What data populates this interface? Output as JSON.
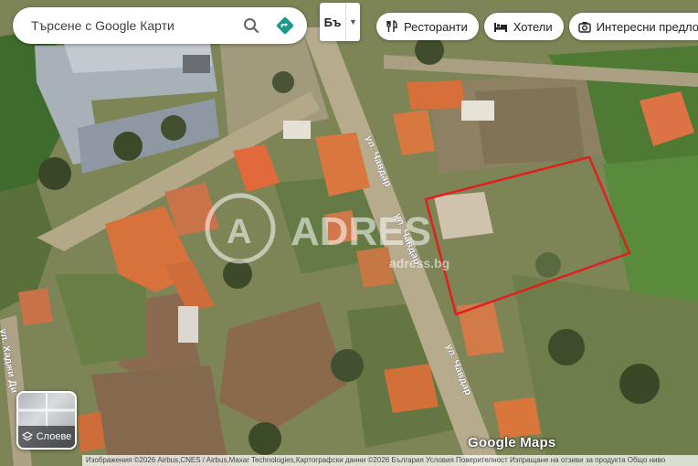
{
  "search": {
    "placeholder": "Търсене с Google Карти"
  },
  "language_button": {
    "label": "Бъ"
  },
  "chips": [
    {
      "label": "Ресторанти",
      "icon": "fork-knife-icon"
    },
    {
      "label": "Хотели",
      "icon": "bed-icon"
    },
    {
      "label": "Интересни предлож",
      "icon": "camera-icon"
    }
  ],
  "layers": {
    "label": "Слоеве"
  },
  "map": {
    "street_labels": [
      "ул. Чавдар",
      "ул. Чавдар",
      "ул. Чавдар",
      "ул. Хаджи Ди"
    ],
    "watermark": {
      "brand": "ADRES",
      "url": "adress.bg"
    },
    "highlight_color": "#e02020"
  },
  "branding": {
    "logo": "Google Maps"
  },
  "attribution": "Изображения ©2026 Airbus,CNES / Airbus,Maxar Technologies,Картографски данни ©2026   България   Условия   Поверителност   Изпращане на отзиви за продукта   Общо ниво"
}
